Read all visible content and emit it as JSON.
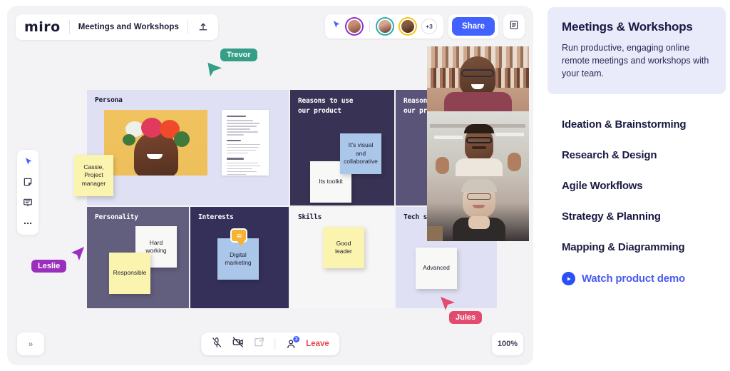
{
  "app": {
    "logo": "miro",
    "board_name": "Meetings and Workshops",
    "upload_icon": "upload-icon",
    "share_label": "Share",
    "overflow_avatars": "+3",
    "notes_icon": "notes-panel-icon",
    "cursor_share_icon": "cursor-share-icon"
  },
  "tools": [
    {
      "name": "select-tool",
      "icon": "cursor-icon"
    },
    {
      "name": "sticky-note-tool",
      "icon": "sticky-note-icon"
    },
    {
      "name": "comment-tool",
      "icon": "comment-icon"
    },
    {
      "name": "more-tools",
      "icon": "ellipsis-icon"
    }
  ],
  "frames": {
    "persona": {
      "title": "Persona",
      "sticky": "Cassie,\nProject\nmanager"
    },
    "reasons_1": {
      "title": "Reasons to use\nour product",
      "sticky_blue": "It's visual and\ncollaborative",
      "sticky_white": "Its toolkit"
    },
    "reasons_2": {
      "title": "Reasons to use\nour product"
    },
    "personality": {
      "title": "Personality",
      "sticky_white": "Hard working",
      "sticky_yellow": "Responsible"
    },
    "interests": {
      "title": "Interests",
      "sticky_blue": "Digital\nmarketing",
      "comment_badge": "comment-bubble-icon"
    },
    "skills": {
      "title": "Skills",
      "sticky_yellow": "Good\nleader"
    },
    "tech_savvy": {
      "title": "Tech savvy",
      "sticky_white": "Advanced"
    }
  },
  "cursors": [
    {
      "name": "Trevor",
      "color": "#359e87"
    },
    {
      "name": "Leslie",
      "color": "#9b2fbd"
    },
    {
      "name": "Jules",
      "color": "#e24a6e"
    }
  ],
  "bottom_bar": {
    "mic_icon": "microphone-muted-icon",
    "camera_icon": "camera-muted-icon",
    "screenshare_icon": "screen-share-icon",
    "participants_icon": "participants-icon",
    "participants_count": "3",
    "leave_label": "Leave"
  },
  "canvas_controls": {
    "expand_label": "»",
    "zoom_level": "100%"
  },
  "right_panel": {
    "promo": {
      "title": "Meetings & Workshops",
      "body": "Run productive, engaging online remote meetings and workshops with your team."
    },
    "links": [
      "Ideation & Brainstorming",
      "Research & Design",
      "Agile Workflows",
      "Strategy & Planning",
      "Mapping & Diagramming"
    ],
    "demo": {
      "label": "Watch product demo",
      "icon": "play-circle-icon"
    }
  },
  "colors": {
    "accent_blue": "#4262ff",
    "link_blue": "#4a5bf0",
    "leave_red": "#e5484d",
    "promo_bg": "#e9eafa"
  }
}
